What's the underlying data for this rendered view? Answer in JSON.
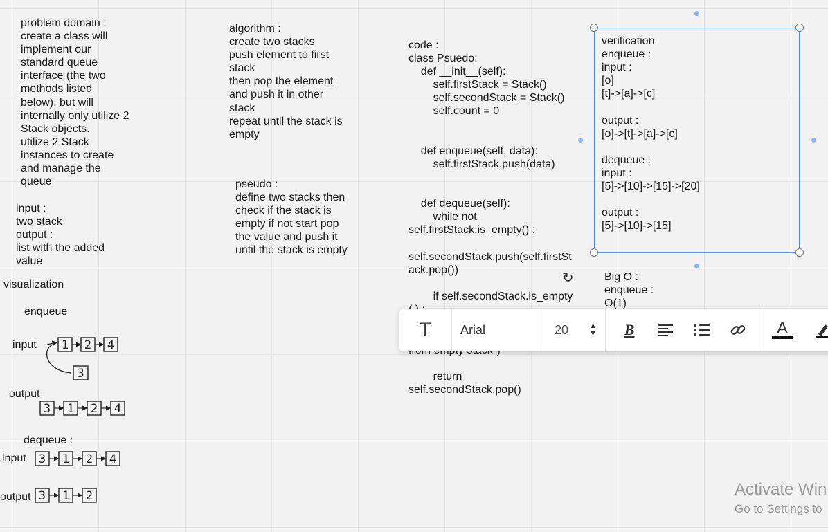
{
  "notes": {
    "problem_domain": "problem domain :\ncreate a class will\nimplement our\nstandard queue\ninterface (the two\nmethods listed\nbelow), but will\ninternally only utilize 2\nStack objects.\n utilize 2 Stack\ninstances to create\nand manage the\nqueue",
    "input_output": "input :\ntwo stack\noutput :\nlist with the added\nvalue",
    "algorithm": "algorithm :\ncreate two stacks\npush element to first\nstack\nthen pop the element\nand push it in other\nstack\nrepeat until the stack is\nempty",
    "pseudo": "pseudo :\ndefine two stacks then\ncheck if the stack is\nempty if not start pop\nthe value and push it\nuntil the stack is empty",
    "code": "code :\nclass Psuedo:\n    def __init__(self):\n        self.firstStack = Stack()\n        self.secondStack = Stack()\n        self.count = 0\n\n\n    def enqueue(self, data):\n        self.firstStack.push(data)\n\n\n    def dequeue(self):\n        while not\nself.firstStack.is_empty() :\n\nself.secondStack.push(self.firstSt\nack.pop())\n\n        if self.secondStack.is_empty\n( ) :",
    "code_tail": "from empty stack\")\n\n        return\nself.secondStack.pop()",
    "verification": "verification\nenqueue :\ninput :\n[o]\n[t]->[a]->[c]\n\noutput :\n[o]->[t]->[a]->[c]\n\ndequeue :\ninput :\n[5]->[10]->[15]->[20]\n\noutput :\n[5]->[10]->[15]",
    "big_o": "Big O :\nenqueue :\nO(1)"
  },
  "visualization": {
    "title": "visualization",
    "enqueue_label": "enqueue",
    "input_label": "input",
    "output_label": "output",
    "dequeue_label": "dequeue :",
    "dequeue_input_label": "input",
    "dequeue_output_label": "output",
    "enqueue_input_nodes": [
      "1",
      "2",
      "4"
    ],
    "enqueue_new_node": "3",
    "enqueue_output_nodes": [
      "3",
      "1",
      "2",
      "4"
    ],
    "dequeue_input_nodes": [
      "3",
      "1",
      "2",
      "4"
    ],
    "dequeue_output_nodes": [
      "3",
      "1",
      "2"
    ]
  },
  "toolbar": {
    "text_tool_icon": "T",
    "font_name": "Arial",
    "font_size": "20",
    "icons": [
      "text-icon",
      "stepper-icon",
      "bold-icon",
      "align-left-icon",
      "bullet-list-icon",
      "link-icon",
      "text-color-icon",
      "highlighter-icon"
    ]
  },
  "watermark": {
    "line1": "Activate Win",
    "line2": "Go to Settings to"
  }
}
